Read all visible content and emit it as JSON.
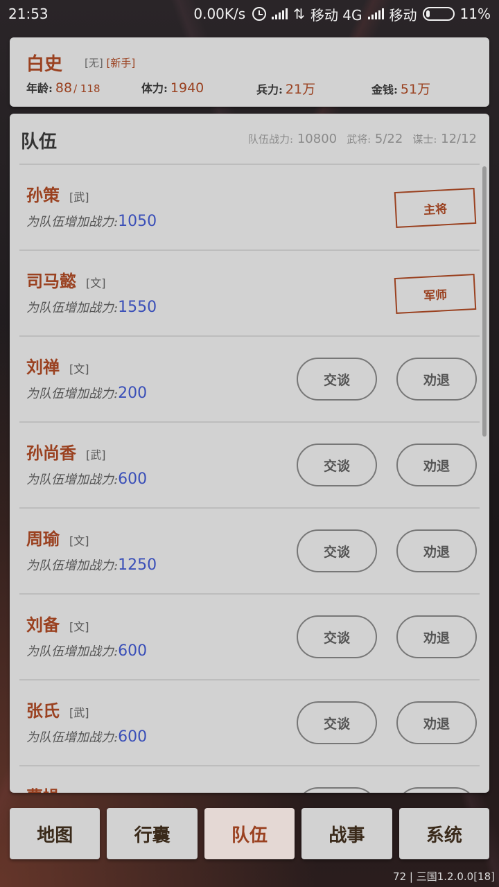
{
  "status": {
    "time": "21:53",
    "speed": "0.00K/s",
    "carrier1": "移动 4G",
    "carrier2": "移动",
    "battery": "11%"
  },
  "profile": {
    "name": "白史",
    "tag1": "[无]",
    "tag2": "[新手]",
    "age_label": "年龄:",
    "age_value": "88",
    "age_max": "/ 118",
    "hp_label": "体力:",
    "hp_value": "1940",
    "troops_label": "兵力:",
    "troops_value": "21万",
    "money_label": "金钱:",
    "money_value": "51万"
  },
  "team": {
    "title": "队伍",
    "power_label": "队伍战力:",
    "power_value": "10800",
    "generals_label": "武将:",
    "generals_value": "5/22",
    "advisors_label": "谋士:",
    "advisors_value": "12/12",
    "desc_label": "为队伍增加战力:",
    "talk_label": "交谈",
    "dismiss_label": "劝退",
    "members": [
      {
        "name": "孙策",
        "type": "[武]",
        "power": "1050",
        "role": "主将"
      },
      {
        "name": "司马懿",
        "type": "[文]",
        "power": "1550",
        "role": "军师"
      },
      {
        "name": "刘禅",
        "type": "[文]",
        "power": "200",
        "role": ""
      },
      {
        "name": "孙尚香",
        "type": "[武]",
        "power": "600",
        "role": ""
      },
      {
        "name": "周瑜",
        "type": "[文]",
        "power": "1250",
        "role": ""
      },
      {
        "name": "刘备",
        "type": "[文]",
        "power": "600",
        "role": ""
      },
      {
        "name": "张氏",
        "type": "[武]",
        "power": "600",
        "role": ""
      },
      {
        "name": "曹操",
        "type": "[文]",
        "power": "",
        "role": ""
      }
    ]
  },
  "nav": {
    "map": "地图",
    "bag": "行囊",
    "team": "队伍",
    "war": "战事",
    "system": "系统"
  },
  "version": "72 | 三国1.2.0.0[18]"
}
